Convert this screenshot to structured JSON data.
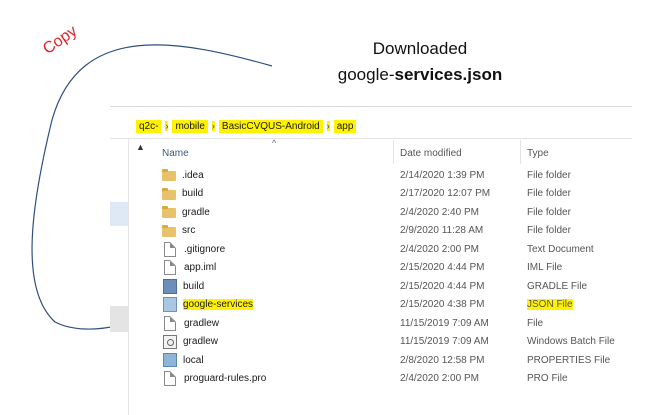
{
  "annotation": {
    "copy_label": "Copy",
    "callout_line1": "Downloaded",
    "callout_line2_prefix": "google-",
    "callout_line2_bold": "services.json",
    "highlight_color": "#fff200",
    "arrow_color": "#2f4f7f",
    "copy_color": "#e0242b"
  },
  "breadcrumb": [
    "q2c-",
    "mobile",
    "BasicCVQUS-Android",
    "app"
  ],
  "columns": {
    "name": "Name",
    "date": "Date modified",
    "type": "Type"
  },
  "files": [
    {
      "name": ".idea",
      "date": "2/14/2020 1:39 PM",
      "type": "File folder",
      "icon": "folder-icon"
    },
    {
      "name": "build",
      "date": "2/17/2020 12:07 PM",
      "type": "File folder",
      "icon": "folder-icon"
    },
    {
      "name": "gradle",
      "date": "2/4/2020 2:40 PM",
      "type": "File folder",
      "icon": "folder-icon"
    },
    {
      "name": "src",
      "date": "2/9/2020 11:28 AM",
      "type": "File folder",
      "icon": "folder-icon"
    },
    {
      "name": ".gitignore",
      "date": "2/4/2020 2:00 PM",
      "type": "Text Document",
      "icon": "text-file-icon"
    },
    {
      "name": "app.iml",
      "date": "2/15/2020 4:44 PM",
      "type": "IML File",
      "icon": "file-icon"
    },
    {
      "name": "build",
      "date": "2/15/2020 4:44 PM",
      "type": "GRADLE File",
      "icon": "gradle-file-icon"
    },
    {
      "name": "google-services",
      "date": "2/15/2020 4:38 PM",
      "type": "JSON File",
      "icon": "json-file-icon"
    },
    {
      "name": "gradlew",
      "date": "11/15/2019 7:09 AM",
      "type": "File",
      "icon": "file-icon"
    },
    {
      "name": "gradlew",
      "date": "11/15/2019 7:09 AM",
      "type": "Windows Batch File",
      "icon": "batch-file-icon"
    },
    {
      "name": "local",
      "date": "2/8/2020 12:58 PM",
      "type": "PROPERTIES File",
      "icon": "properties-file-icon"
    },
    {
      "name": "proguard-rules.pro",
      "date": "2/4/2020 2:00 PM",
      "type": "PRO File",
      "icon": "file-icon"
    }
  ]
}
